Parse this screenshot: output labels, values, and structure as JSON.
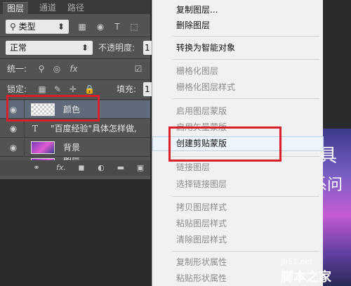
{
  "panel": {
    "tabs": [
      "图层",
      "通道",
      "路径"
    ],
    "filter_kind": "类型",
    "blend_mode": "正常",
    "opacity_label": "不透明度:",
    "opacity_value": "1",
    "unify_label": "统一:",
    "lock_label": "锁定:",
    "fill_label": "填充:",
    "fill_value": "1",
    "layers": [
      {
        "name": "颜色",
        "thumb": "transparent"
      },
      {
        "name": "\"百度经验\"具体怎样做,",
        "thumb": "text",
        "glyph": "T"
      },
      {
        "name": "背景",
        "thumb": "image"
      },
      {
        "name": "图层",
        "thumb": "image"
      }
    ],
    "bottom_icons": [
      "link-icon",
      "fx-icon",
      "mask-icon",
      "adjustment-icon",
      "group-icon",
      "new-layer-icon"
    ],
    "bottom_glyphs": [
      "⚭",
      "fx.",
      "◼",
      "◐",
      "▬",
      "▣"
    ],
    "filter_icons": [
      "▦",
      "◉",
      "T",
      "⬚"
    ]
  },
  "menu": {
    "items": [
      {
        "label": "复制图层...",
        "disabled": false
      },
      {
        "label": "删除图层",
        "disabled": false
      },
      {
        "label": "转换为智能对象",
        "disabled": false
      },
      {
        "label": "栅格化图层",
        "disabled": true
      },
      {
        "label": "栅格化图层样式",
        "disabled": true
      },
      {
        "label": "启用图层蒙版",
        "disabled": true
      },
      {
        "label": "启用矢量蒙版",
        "disabled": true
      },
      {
        "label": "创建剪贴蒙版",
        "disabled": false,
        "highlighted": true
      },
      {
        "label": "链接图层",
        "disabled": true
      },
      {
        "label": "选择链接图层",
        "disabled": true
      },
      {
        "label": "拷贝图层样式",
        "disabled": true
      },
      {
        "label": "粘贴图层样式",
        "disabled": true
      },
      {
        "label": "清除图层样式",
        "disabled": true
      },
      {
        "label": "复制形状属性",
        "disabled": true
      },
      {
        "label": "粘贴形状属性",
        "disabled": true
      }
    ]
  },
  "background_image": {
    "text1": "具",
    "text2": "系问"
  },
  "watermark": {
    "site": "jb51.net",
    "brand": "脚本之家"
  },
  "colors": {
    "highlight_box": "#d9202a",
    "panel_bg": "#535353",
    "menu_bg": "#f1f1f1"
  }
}
